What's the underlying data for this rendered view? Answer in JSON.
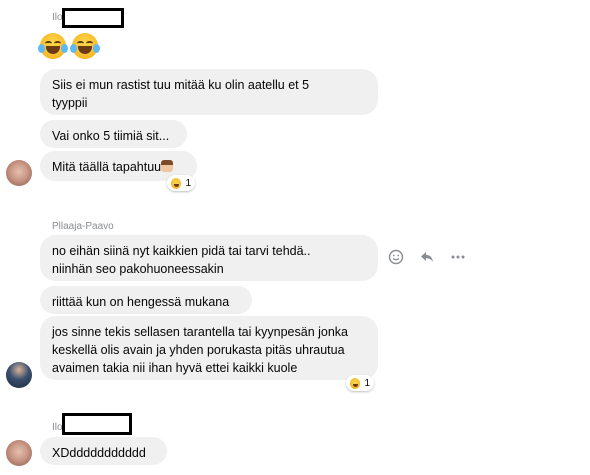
{
  "groups": [
    {
      "sender": "Ilo",
      "big_emoji_count": 2,
      "messages": [
        "Siis ei mun rastist tuu mitää ku olin aatellu et 5\ntyyppii",
        "Vai onko 5 tiimiä sit...",
        "Mitä täällä tapahtuu"
      ],
      "reaction_count": "1"
    },
    {
      "sender": "Pllaaja-Paavo",
      "messages": [
        "no eihän siinä nyt kaikkien pidä tai tarvi tehdä..\nniinhän seo pakohuoneessakin",
        "riittää kun on hengessä mukana",
        "jos sinne tekis sellasen tarantella tai kyynpesän jonka\nkeskellä olis avain ja yhden porukasta pitäs uhrautua\navaimen takia nii ihan hyvä ettei kaikki kuole"
      ],
      "reaction_count": "1"
    },
    {
      "sender": "Ilo",
      "messages": [
        "XDddddddddddd"
      ]
    }
  ],
  "icons": {
    "react": "smile-icon",
    "reply": "reply-icon",
    "more": "more-icon"
  }
}
